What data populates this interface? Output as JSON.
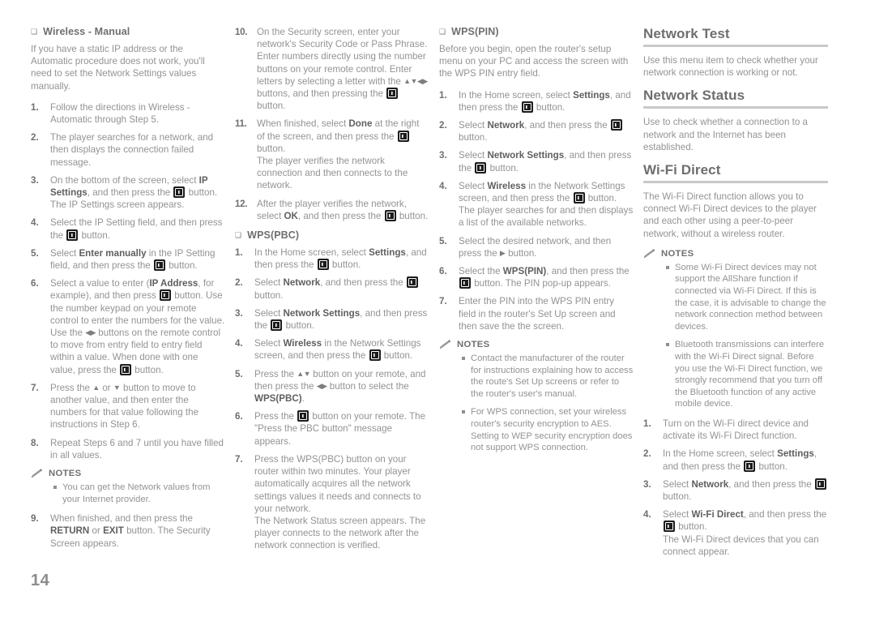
{
  "page": {
    "number": "14"
  },
  "icons": {
    "enter_button": "enter-button-icon",
    "notes_pencil": "pencil-icon",
    "square_bullet": "❑",
    "up": "▲",
    "down": "▼",
    "left": "◀",
    "right": "▶"
  },
  "column1": {
    "subheading": "Wireless - Manual",
    "intro": "If you have a static IP address or the Automatic procedure does not work, you'll need to set the Network Settings values manually.",
    "steps": [
      {
        "num": "1.",
        "text": "Follow the directions in Wireless - Automatic through Step 5."
      },
      {
        "num": "2.",
        "text": "The player searches for a network, and then displays the connection failed message."
      },
      {
        "num": "3.",
        "parts": [
          "On the bottom of the screen, select ",
          "IP Settings",
          ", and then press the ",
          "ENTER",
          " button.",
          "The IP Settings screen appears."
        ]
      },
      {
        "num": "4.",
        "parts": [
          "Select the IP Setting field, and then press the ",
          "ENTER",
          " button."
        ]
      },
      {
        "num": "5.",
        "parts": [
          "Select ",
          "Enter manually",
          " in the IP Setting field, and then press the ",
          "ENTER",
          " button."
        ]
      },
      {
        "num": "6.",
        "parts": [
          "Select a value to enter (",
          "IP Address",
          ", for example), and then press ",
          "ENTER",
          " button. Use the number keypad on your remote control to enter the numbers for the value. Use the ",
          "LEFTRIGHT",
          " buttons on the remote control to move from entry field to entry field within a value. When done with one value, press the ",
          "ENTER",
          " button."
        ]
      },
      {
        "num": "7.",
        "parts": [
          "Press the ",
          "UP",
          " or ",
          "DOWN",
          " button to move to another value, and then enter the numbers for that value following the instructions in Step 6."
        ]
      },
      {
        "num": "8.",
        "text": "Repeat Steps 6 and 7 until you have filled in all values."
      }
    ],
    "notes_title": "NOTES",
    "notes": [
      "You can get the Network values from your Internet provider."
    ],
    "steps_after_notes": [
      {
        "num": "9.",
        "parts": [
          "When finished, and then press the ",
          "RETURN",
          " or ",
          "EXIT",
          " button. The Security Screen appears."
        ]
      }
    ]
  },
  "column2": {
    "steps": [
      {
        "num": "10.",
        "parts": [
          "On the Security screen, enter your network's Security Code or Pass Phrase. Enter numbers directly using the number buttons on your remote control. Enter letters by selecting a letter with the ",
          "UPDOWNLEFTRIGHT",
          " buttons, and then pressing the ",
          "ENTER",
          " button."
        ]
      },
      {
        "num": "11.",
        "parts": [
          "When finished, select ",
          "Done",
          " at the right of the screen, and then press the ",
          "ENTER",
          " button.",
          "The player verifies the network connection and then connects to the network."
        ]
      },
      {
        "num": "12.",
        "parts": [
          "After the player verifies the network, select ",
          "OK",
          ", and then press the ",
          "ENTER",
          " button."
        ]
      }
    ],
    "subheading": "WPS(PBC)",
    "wps_steps": [
      {
        "num": "1.",
        "parts": [
          "In the Home screen, select ",
          "Settings",
          ", and then press the ",
          "ENTER",
          " button."
        ]
      },
      {
        "num": "2.",
        "parts": [
          "Select ",
          "Network",
          ", and then press the ",
          "ENTER",
          " button."
        ]
      },
      {
        "num": "3.",
        "parts": [
          "Select ",
          "Network Settings",
          ", and then press the ",
          "ENTER",
          " button."
        ]
      },
      {
        "num": "4.",
        "parts": [
          "Select ",
          "Wireless",
          " in the Network Settings screen, and then press the ",
          "ENTER",
          " button."
        ]
      },
      {
        "num": "5.",
        "parts": [
          "Press the ",
          "UPDOWN",
          " button on your remote, and then press the ",
          "LEFTRIGHT",
          " button to select the ",
          "WPS(PBC)",
          "."
        ]
      },
      {
        "num": "6.",
        "parts": [
          "Press the ",
          "ENTER",
          " button on your remote. The \"Press the PBC button\" message appears."
        ]
      },
      {
        "num": "7.",
        "text": "Press the WPS(PBC) button on your router within two minutes. Your player automatically acquires all the network settings values it needs and connects to your network.\nThe Network Status screen appears. The player connects to the network after the network connection is verified."
      }
    ]
  },
  "column3": {
    "subheading": "WPS(PIN)",
    "intro": "Before you begin, open the router's setup menu on your PC and access the screen with the WPS PIN entry field.",
    "steps": [
      {
        "num": "1.",
        "parts": [
          "In the Home screen, select ",
          "Settings",
          ", and then press the ",
          "ENTER",
          " button."
        ]
      },
      {
        "num": "2.",
        "parts": [
          "Select ",
          "Network",
          ", and then press the ",
          "ENTER",
          " button."
        ]
      },
      {
        "num": "3.",
        "parts": [
          "Select ",
          "Network Settings",
          ", and then press the ",
          "ENTER",
          " button."
        ]
      },
      {
        "num": "4.",
        "parts": [
          "Select ",
          "Wireless",
          " in the Network Settings screen, and then press the ",
          "ENTER",
          " button.",
          "The player searches for and then displays a list of the available networks."
        ]
      },
      {
        "num": "5.",
        "parts": [
          "Select the desired network, and then press the ",
          "RIGHT",
          " button."
        ]
      },
      {
        "num": "6.",
        "parts": [
          "Select the ",
          "WPS(PIN)",
          ", and then press the ",
          "ENTER",
          " button. The PIN pop-up appears."
        ]
      },
      {
        "num": "7.",
        "text": "Enter the PIN into the WPS PIN entry field in the router's Set Up screen and then save the the screen."
      }
    ],
    "notes_title": "NOTES",
    "notes": [
      "Contact the manufacturer of the router for instructions explaining how to access the route's Set Up screens or refer to the router's user's manual.",
      "For WPS connection, set your wireless router's security encryption to AES. Setting to WEP security encryption does not support WPS connection."
    ]
  },
  "column4": {
    "sections": [
      {
        "heading": "Network Test",
        "body": "Use this menu item to check whether your network connection is working or not."
      },
      {
        "heading": "Network Status",
        "body": "Use to check whether a connection to a network and the Internet has been established."
      },
      {
        "heading": "Wi-Fi Direct",
        "body": "The Wi-Fi Direct function allows you to connect Wi-Fi Direct devices to the player and each other using a peer-to-peer network, without a wireless router."
      }
    ],
    "notes_title": "NOTES",
    "notes": [
      "Some Wi-Fi Direct devices may not support the AllShare function if connected via Wi-Fi Direct. If this is the case, it is advisable to change the network connection method between devices.",
      "Bluetooth transmissions can interfere with the Wi-Fi Direct signal. Before you use the Wi-Fi Direct function, we strongly recommend that you turn off the Bluetooth function of any active mobile device."
    ],
    "steps": [
      {
        "num": "1.",
        "text": "Turn on the Wi-Fi direct device and activate its Wi-Fi Direct function."
      },
      {
        "num": "2.",
        "parts": [
          "In the Home screen, select ",
          "Settings",
          ", and then press the ",
          "ENTER",
          " button."
        ]
      },
      {
        "num": "3.",
        "parts": [
          "Select ",
          "Network",
          ", and then press the ",
          "ENTER",
          " button."
        ]
      },
      {
        "num": "4.",
        "parts": [
          "Select ",
          "Wi-Fi Direct",
          ", and then press the ",
          "ENTER",
          " button.",
          "The Wi-Fi Direct devices that you can connect appear."
        ]
      }
    ]
  }
}
